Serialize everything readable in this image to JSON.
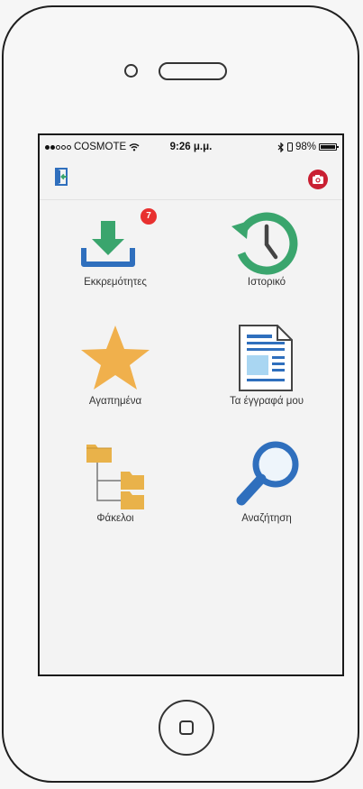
{
  "status_bar": {
    "carrier": "COSMOTE",
    "time": "9:26 μ.μ.",
    "battery_percent": "98%",
    "battery_level": 0.98,
    "signal_bars_filled": 2,
    "signal_bars_total": 5,
    "wifi_icon": "wifi-icon",
    "bluetooth_icon": "bluetooth-icon"
  },
  "toolbar": {
    "left_icon": "logout-icon",
    "right_icon": "camera-icon",
    "accent_color": "#2f6fbd",
    "camera_color": "#c91f32"
  },
  "menu": {
    "items": [
      {
        "label": "Εκκρεμότητες",
        "icon": "download-icon",
        "badge": "7"
      },
      {
        "label": "Ιστορικό",
        "icon": "history-clock-icon"
      },
      {
        "label": "Αγαπημένα",
        "icon": "star-icon"
      },
      {
        "label": "Τα έγγραφά μου",
        "icon": "document-icon"
      },
      {
        "label": "Φάκελοι",
        "icon": "folder-tree-icon"
      },
      {
        "label": "Αναζήτηση",
        "icon": "magnifier-icon"
      }
    ]
  },
  "colors": {
    "green": "#3aa56d",
    "blue": "#2f6fbd",
    "star": "#f0b04c",
    "folder": "#e9b24a",
    "badge": "#e8302f"
  }
}
